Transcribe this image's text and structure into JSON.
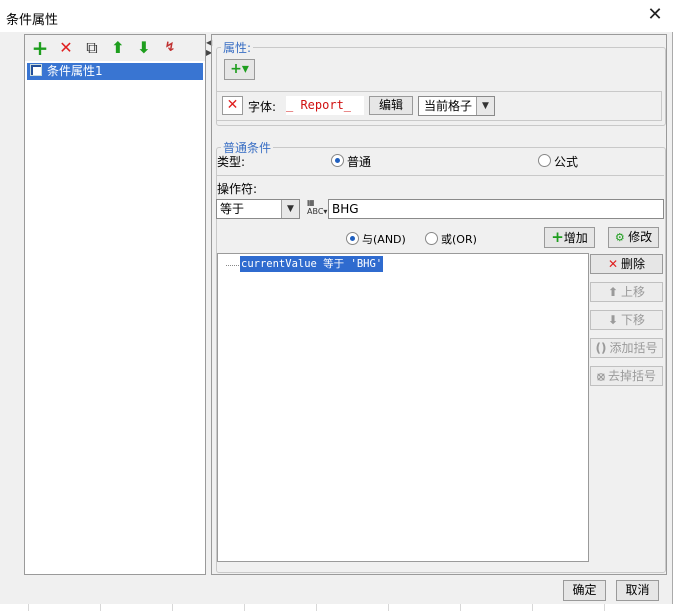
{
  "window": {
    "title": "条件属性",
    "close_label": "✕"
  },
  "left_toolbar": {
    "add_icon": "+",
    "delete_icon": "✕",
    "copy_icon": "⧉",
    "up_icon": "⬆",
    "down_icon": "⬇",
    "sort_icon": "↯"
  },
  "tree": {
    "items": [
      {
        "label": "条件属性1"
      }
    ]
  },
  "properties": {
    "legend": "属性:",
    "add_label": "+▾",
    "font_label": "字体:",
    "font_preview": "_ Report_",
    "edit_button": "编辑",
    "scope_value": "当前格子",
    "combo_arrow": "▼"
  },
  "condition": {
    "legend": "普通条件",
    "type_label": "类型:",
    "type_normal": "普通",
    "type_formula": "公式",
    "operator_label": "操作符:",
    "operator_value": "等于",
    "operand_value": "BHG",
    "and_label": "与(AND)",
    "or_label": "或(OR)",
    "add_button": "增加",
    "modify_button": "修改"
  },
  "conditions_list": [
    {
      "text": "currentValue 等于 'BHG'"
    }
  ],
  "side_buttons": {
    "delete": "删除",
    "move_up": "上移",
    "move_down": "下移",
    "add_bracket": "添加括号",
    "remove_bracket": "去掉括号"
  },
  "footer": {
    "ok": "确定",
    "cancel": "取消"
  },
  "colors": {
    "accent": "#3975d2",
    "green": "#1e9e1e",
    "red": "#e02020"
  }
}
